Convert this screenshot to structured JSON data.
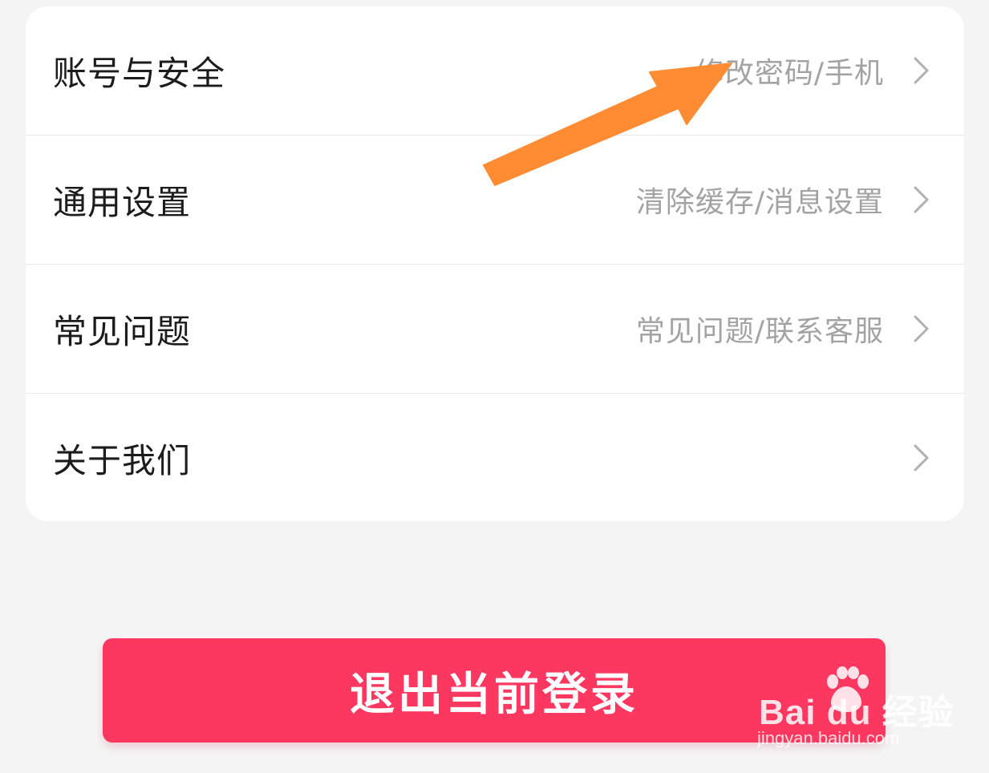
{
  "settings": {
    "rows": [
      {
        "label": "账号与安全",
        "hint": "修改密码/手机"
      },
      {
        "label": "通用设置",
        "hint": "清除缓存/消息设置"
      },
      {
        "label": "常见问题",
        "hint": "常见问题/联系客服"
      },
      {
        "label": "关于我们",
        "hint": ""
      }
    ]
  },
  "logout": {
    "label": "退出当前登录"
  },
  "watermark": {
    "brand": "Bai du 经验",
    "url": "jingyan.baidu.com"
  },
  "colors": {
    "accent": "#fc3760",
    "arrow": "#ff8c33",
    "background": "#f4f4f4",
    "card": "#ffffff"
  },
  "icons": {
    "row_chevron": "chevron-right-icon",
    "annotation": "arrow-annotation-icon",
    "watermark": "baidu-paw-icon"
  }
}
